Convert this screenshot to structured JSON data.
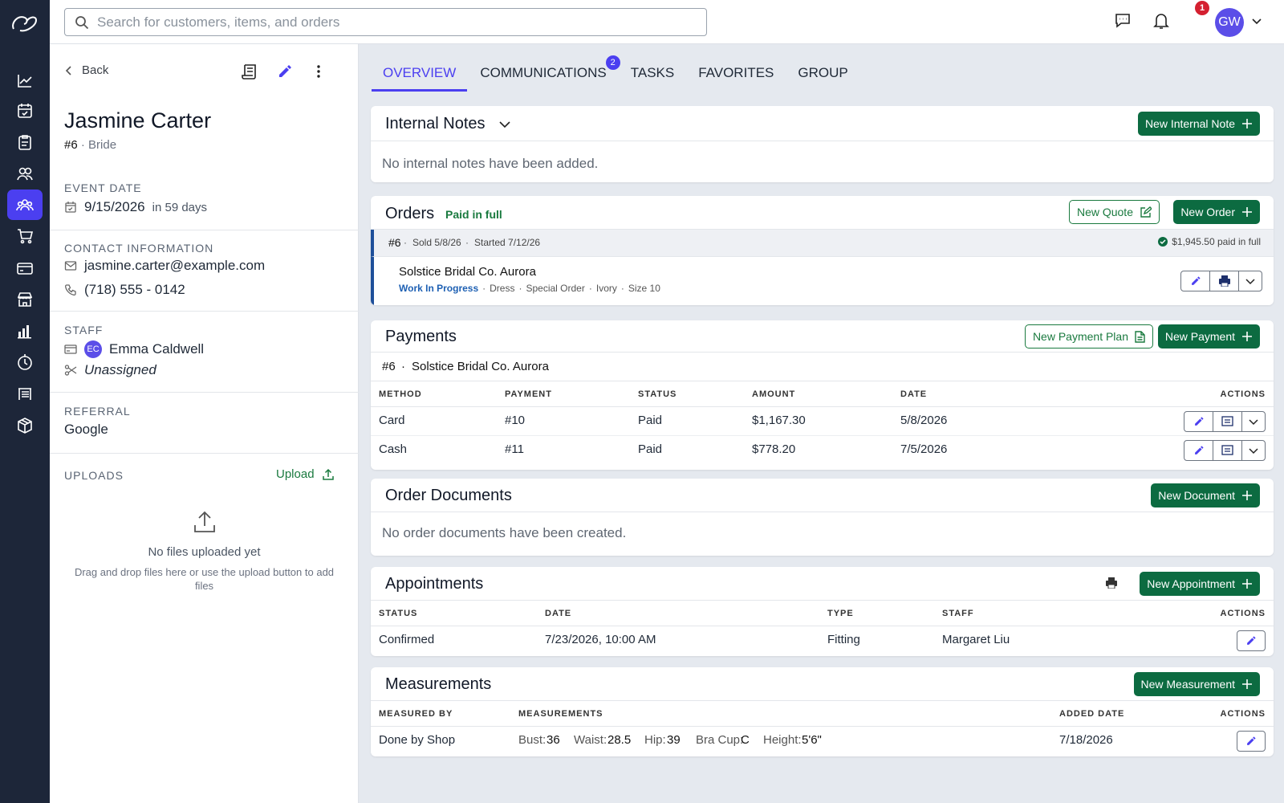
{
  "search": {
    "placeholder": "Search for customers, items, and orders"
  },
  "user": {
    "initials": "GW",
    "notification_count": "1"
  },
  "customer": {
    "back_label": "Back",
    "name": "Jasmine Carter",
    "number": "#6",
    "role": "Bride",
    "event_date_label": "EVENT DATE",
    "event_date": "9/15/2026",
    "event_relative": "in 59 days",
    "contact_label": "CONTACT INFORMATION",
    "email": "jasmine.carter@example.com",
    "phone": "(718) 555 - 0142",
    "staff_label": "STAFF",
    "staff_initials": "EC",
    "staff_name": "Emma Caldwell",
    "staff_secondary": "Unassigned",
    "referral_label": "REFERRAL",
    "referral": "Google",
    "uploads_label": "UPLOADS",
    "upload_button": "Upload",
    "no_files": "No files uploaded yet",
    "no_files_hint": "Drag and drop files here or use the upload button to add files"
  },
  "tabs": [
    {
      "label": "OVERVIEW"
    },
    {
      "label": "COMMUNICATIONS",
      "badge": "2"
    },
    {
      "label": "TASKS"
    },
    {
      "label": "FAVORITES"
    },
    {
      "label": "GROUP"
    }
  ],
  "internal_notes": {
    "title": "Internal Notes",
    "button": "New Internal Note",
    "empty": "No internal notes have been added."
  },
  "orders": {
    "title": "Orders",
    "status": "Paid in full",
    "new_quote": "New Quote",
    "new_order": "New Order",
    "order_number": "#6",
    "sold": "Sold 5/8/26",
    "started": "Started 7/12/26",
    "paid_summary": "$1,945.50 paid in full",
    "item_name": "Solstice Bridal Co. Aurora",
    "item_status": "Work In Progress",
    "item_tags": [
      "Dress",
      "Special Order",
      "Ivory",
      "Size 10"
    ]
  },
  "payments": {
    "title": "Payments",
    "new_plan": "New Payment Plan",
    "new_payment": "New Payment",
    "sub_number": "#6",
    "sub_item": "Solstice Bridal Co. Aurora",
    "columns": [
      "METHOD",
      "PAYMENT",
      "STATUS",
      "AMOUNT",
      "DATE",
      "ACTIONS"
    ],
    "rows": [
      {
        "method": "Card",
        "payment": "#10",
        "status": "Paid",
        "amount": "$1,167.30",
        "date": "5/8/2026"
      },
      {
        "method": "Cash",
        "payment": "#11",
        "status": "Paid",
        "amount": "$778.20",
        "date": "7/5/2026"
      }
    ]
  },
  "order_documents": {
    "title": "Order Documents",
    "button": "New Document",
    "empty": "No order documents have been created."
  },
  "appointments": {
    "title": "Appointments",
    "button": "New Appointment",
    "columns": [
      "STATUS",
      "DATE",
      "TYPE",
      "STAFF",
      "ACTIONS"
    ],
    "rows": [
      {
        "status": "Confirmed",
        "date": "7/23/2026, 10:00 AM",
        "type": "Fitting",
        "staff": "Margaret Liu"
      }
    ]
  },
  "measurements": {
    "title": "Measurements",
    "button": "New Measurement",
    "columns": [
      "MEASURED BY",
      "MEASUREMENTS",
      "ADDED DATE",
      "ACTIONS"
    ],
    "rows": [
      {
        "measured_by": "Done by Shop",
        "bust_label": "Bust:",
        "bust": "36",
        "waist_label": "Waist:",
        "waist": "28.5",
        "hip_label": "Hip:",
        "hip": "39",
        "bra_label": "Bra Cup:",
        "bra": "C",
        "height_label": "Height:",
        "height": "5'6\"",
        "added": "7/18/2026"
      }
    ]
  },
  "colors": {
    "brand": "#4b3ff0",
    "action_green": "#0c6b41",
    "rail": "#1d2639"
  }
}
